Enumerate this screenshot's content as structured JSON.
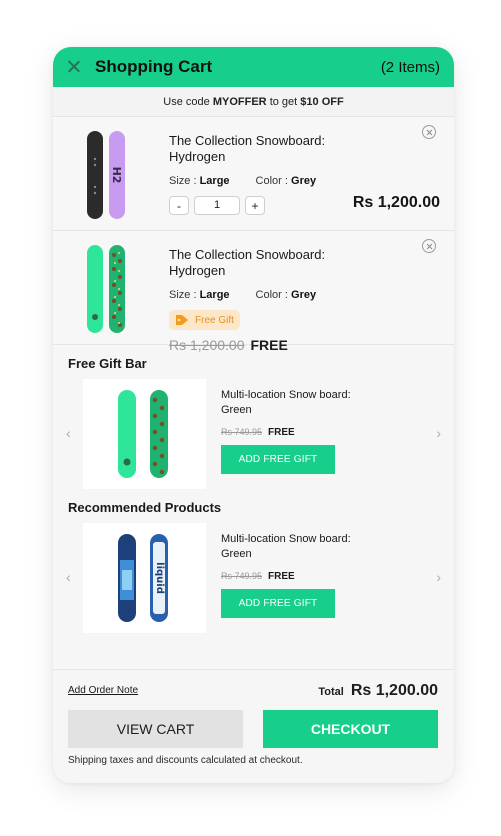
{
  "header": {
    "title": "Shopping Cart",
    "count": "(2 Items)"
  },
  "promo": {
    "prefix": "Use code",
    "code": "MYOFFER",
    "middle": "to get",
    "discount": "$10 OFF"
  },
  "items": [
    {
      "title": "The Collection Snowboard: Hydrogen",
      "size_label": "Size :",
      "size": "Large",
      "color_label": "Color :",
      "color": "Grey",
      "qty_minus": "-",
      "qty": "1",
      "qty_plus": "+",
      "price": "Rs 1,200.00"
    },
    {
      "title": "The Collection Snowboard: Hydrogen",
      "size_label": "Size :",
      "size": "Large",
      "color_label": "Color :",
      "color": "Grey",
      "badge": "Free Gift",
      "original_price": "Rs 1,200.00",
      "price": "FREE"
    }
  ],
  "free_gift_bar": {
    "title": "Free Gift Bar",
    "product": {
      "title": "Multi-location Snow board: Green",
      "original_price": "Rs 749.95",
      "price": "FREE",
      "button": "ADD FREE GIFT"
    }
  },
  "recommended": {
    "title": "Recommended Products",
    "product": {
      "title": "Multi-location Snow board: Green",
      "original_price": "Rs 749.95",
      "price": "FREE",
      "button": "ADD FREE GIFT"
    }
  },
  "footer": {
    "order_note": "Add Order Note",
    "total_label": "Total",
    "total_value": "Rs 1,200.00",
    "view_cart": "VIEW CART",
    "checkout": "CHECKOUT",
    "shipping_note": "Shipping taxes and discounts calculated at checkout."
  },
  "colors": {
    "accent": "#17cf8b",
    "badge_bg": "#fde7c9",
    "badge_text": "#e8921c",
    "board_purple": "#c79cf0",
    "board_dark": "#2b2b2b"
  },
  "icons": {
    "close": "close-icon",
    "remove": "remove-circle-icon",
    "tag": "tag-icon",
    "prev": "chevron-left-icon",
    "next": "chevron-right-icon"
  }
}
